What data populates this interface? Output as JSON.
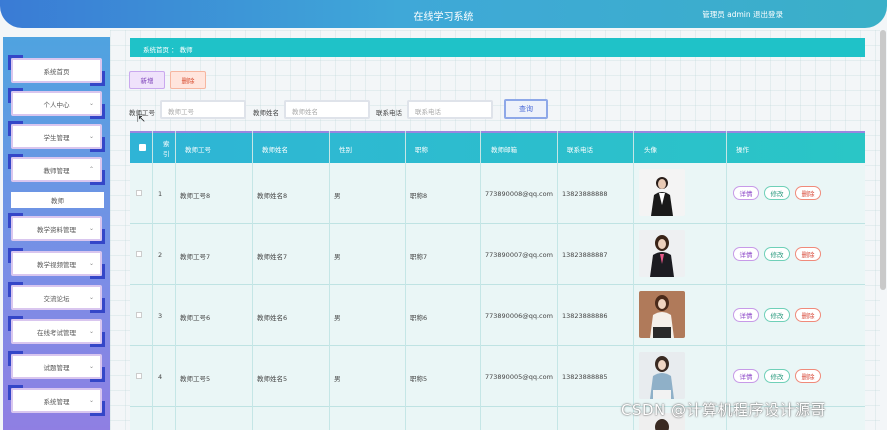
{
  "header": {
    "title": "在线学习系统",
    "user_text": "管理员 admin  退出登录"
  },
  "sidebar": {
    "items": [
      {
        "label": "系统首页",
        "chevron": false
      },
      {
        "label": "个人中心",
        "chevron": true
      },
      {
        "label": "学生管理",
        "chevron": true
      },
      {
        "label": "教师管理",
        "chevron": true,
        "expanded": true
      },
      {
        "label": "教学资料管理",
        "chevron": true
      },
      {
        "label": "教学视频管理",
        "chevron": true
      },
      {
        "label": "交流论坛",
        "chevron": true
      },
      {
        "label": "在线考试管理",
        "chevron": true
      },
      {
        "label": "试题管理",
        "chevron": true
      },
      {
        "label": "系统管理",
        "chevron": true
      }
    ],
    "sub_item": "教师"
  },
  "breadcrumb": "系统首页  ：  教师",
  "toolbar": {
    "add_label": "新增",
    "delete_label": "删除"
  },
  "search": {
    "teacher_no_label": "教师工号",
    "teacher_no_placeholder": "教师工号",
    "teacher_name_label": "教师姓名",
    "teacher_name_placeholder": "教师姓名",
    "phone_label": "联系电话",
    "phone_placeholder": "联系电话",
    "search_label": "查询"
  },
  "table": {
    "headers": [
      "索引",
      "教师工号",
      "教师姓名",
      "性别",
      "职称",
      "教师邮箱",
      "联系电话",
      "头像",
      "操作"
    ],
    "rows": [
      {
        "index": "1",
        "no": "教师工号8",
        "name": "教师姓名8",
        "gender": "男",
        "title": "职称8",
        "email": "773890008@qq.com",
        "phone": "13823888888"
      },
      {
        "index": "2",
        "no": "教师工号7",
        "name": "教师姓名7",
        "gender": "男",
        "title": "职称7",
        "email": "773890007@qq.com",
        "phone": "13823888887"
      },
      {
        "index": "3",
        "no": "教师工号6",
        "name": "教师姓名6",
        "gender": "男",
        "title": "职称6",
        "email": "773890006@qq.com",
        "phone": "13823888886"
      },
      {
        "index": "4",
        "no": "教师工号5",
        "name": "教师姓名5",
        "gender": "男",
        "title": "职称5",
        "email": "773890005@qq.com",
        "phone": "13823888885"
      }
    ],
    "actions": {
      "detail": "详情",
      "edit": "修改",
      "delete": "删除"
    }
  },
  "watermark": "CSDN @计算机程序设计源哥",
  "colors": {
    "accent": "#1fc2c8",
    "header_blue": "#3a7bd5",
    "sidebar_purple": "#8f7fe3"
  }
}
